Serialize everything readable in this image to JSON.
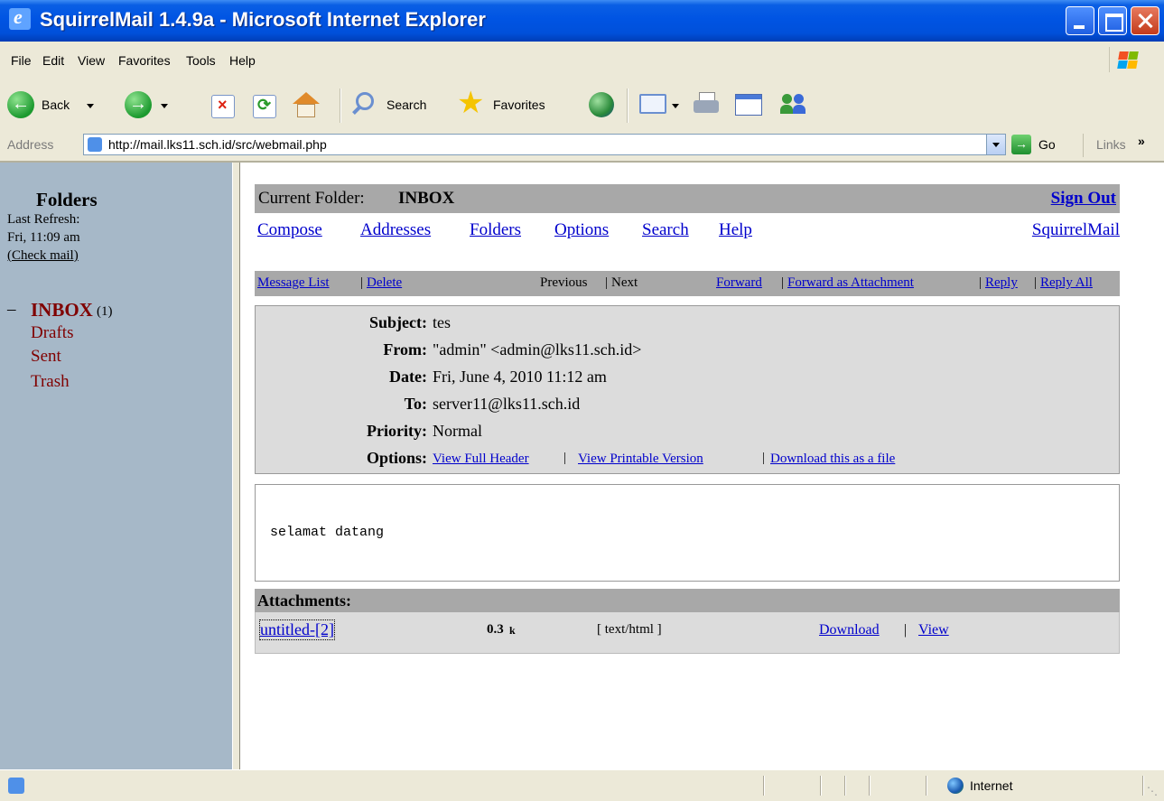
{
  "window": {
    "title": "SquirrelMail 1.4.9a - Microsoft Internet Explorer"
  },
  "menu": {
    "items": [
      "File",
      "Edit",
      "View",
      "Favorites",
      "Tools",
      "Help"
    ]
  },
  "toolbar": {
    "back_label": "Back",
    "search_label": "Search",
    "favorites_label": "Favorites"
  },
  "address": {
    "label": "Address",
    "url": "http://mail.lks11.sch.id/src/webmail.php",
    "go_label": "Go",
    "links_label": "Links"
  },
  "sidebar": {
    "title": "Folders",
    "refresh_label": "Last Refresh:",
    "refresh_time": "Fri, 11:09 am",
    "check_mail": "(Check mail)",
    "folders": [
      {
        "name": "INBOX",
        "count": "(1)",
        "collapse": "–"
      },
      {
        "name": "Drafts"
      },
      {
        "name": "Sent"
      },
      {
        "name": "Trash"
      }
    ]
  },
  "header": {
    "current_folder_label": "Current Folder:",
    "current_folder": "INBOX",
    "sign_out": "Sign Out",
    "nav": [
      "Compose",
      "Addresses",
      "Folders",
      "Options",
      "Search",
      "Help"
    ],
    "brand": "SquirrelMail"
  },
  "actions": {
    "message_list": "Message List",
    "delete": "Delete",
    "previous": "Previous",
    "next": "Next",
    "forward": "Forward",
    "forward_attachment": "Forward as Attachment",
    "reply": "Reply",
    "reply_all": "Reply All"
  },
  "message": {
    "subject_label": "Subject:",
    "subject": "tes",
    "from_label": "From:",
    "from": "\"admin\" <admin@lks11.sch.id>",
    "date_label": "Date:",
    "date": "Fri, June 4, 2010 11:12 am",
    "to_label": "To:",
    "to": "server11@lks11.sch.id",
    "priority_label": "Priority:",
    "priority": "Normal",
    "options_label": "Options:",
    "options": [
      "View Full Header",
      "View Printable Version",
      "Download this as a file"
    ],
    "body": "selamat datang"
  },
  "attachments": {
    "title": "Attachments:",
    "file_name": "untitled-[2]",
    "size": "0.3",
    "size_unit": "k",
    "type": "[ text/html ]",
    "download": "Download",
    "view": "View"
  },
  "status": {
    "zone": "Internet"
  },
  "colors": {
    "left_pane": "#A6B8C8",
    "header_band": "#A8A8A8",
    "message_box": "#DCDCDC",
    "link": "#0000CC",
    "folder": "#800000"
  }
}
